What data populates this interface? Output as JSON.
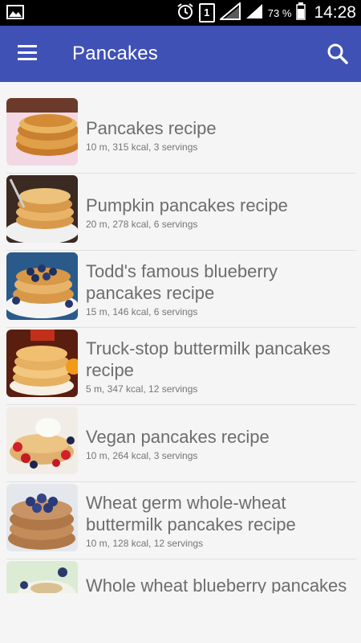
{
  "status_bar": {
    "battery_percent": "73 %",
    "sim_label": "1",
    "time": "14:28",
    "icons": [
      "image-icon",
      "alarm-icon",
      "sim-icon",
      "signal-icon",
      "signal-icon",
      "battery-icon"
    ]
  },
  "app_bar": {
    "title": "Pancakes",
    "color": "#3f51b5",
    "menu_icon": "hamburger-menu-icon",
    "search_icon": "search-icon"
  },
  "recipes": [
    {
      "title": "Pancakes recipe",
      "meta": "10 m, 315 kcal, 3 servings"
    },
    {
      "title": "Pumpkin pancakes recipe",
      "meta": "20 m, 278 kcal, 6 servings"
    },
    {
      "title": "Todd's famous blueberry pancakes recipe",
      "meta": "15 m, 146 kcal, 6 servings"
    },
    {
      "title": "Truck-stop buttermilk pancakes recipe",
      "meta": "5 m, 347 kcal, 12 servings"
    },
    {
      "title": "Vegan pancakes recipe",
      "meta": "10 m, 264 kcal, 3 servings"
    },
    {
      "title": "Wheat germ whole-wheat buttermilk pancakes recipe",
      "meta": "10 m, 128 kcal, 12 servings"
    },
    {
      "title": "Whole wheat blueberry pancakes recipe",
      "meta": ""
    }
  ]
}
